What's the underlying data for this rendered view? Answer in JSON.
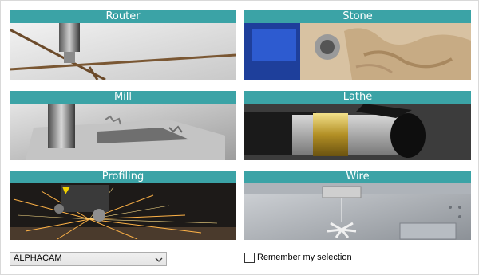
{
  "accent": "#3ba3a6",
  "tiles": [
    {
      "label": "Router"
    },
    {
      "label": "Stone"
    },
    {
      "label": "Mill"
    },
    {
      "label": "Lathe"
    },
    {
      "label": "Profiling"
    },
    {
      "label": "Wire"
    }
  ],
  "product_select": {
    "value": "ALPHACAM",
    "icon": "chevron-down-icon"
  },
  "remember": {
    "label": "Remember my selection",
    "checked": false
  }
}
